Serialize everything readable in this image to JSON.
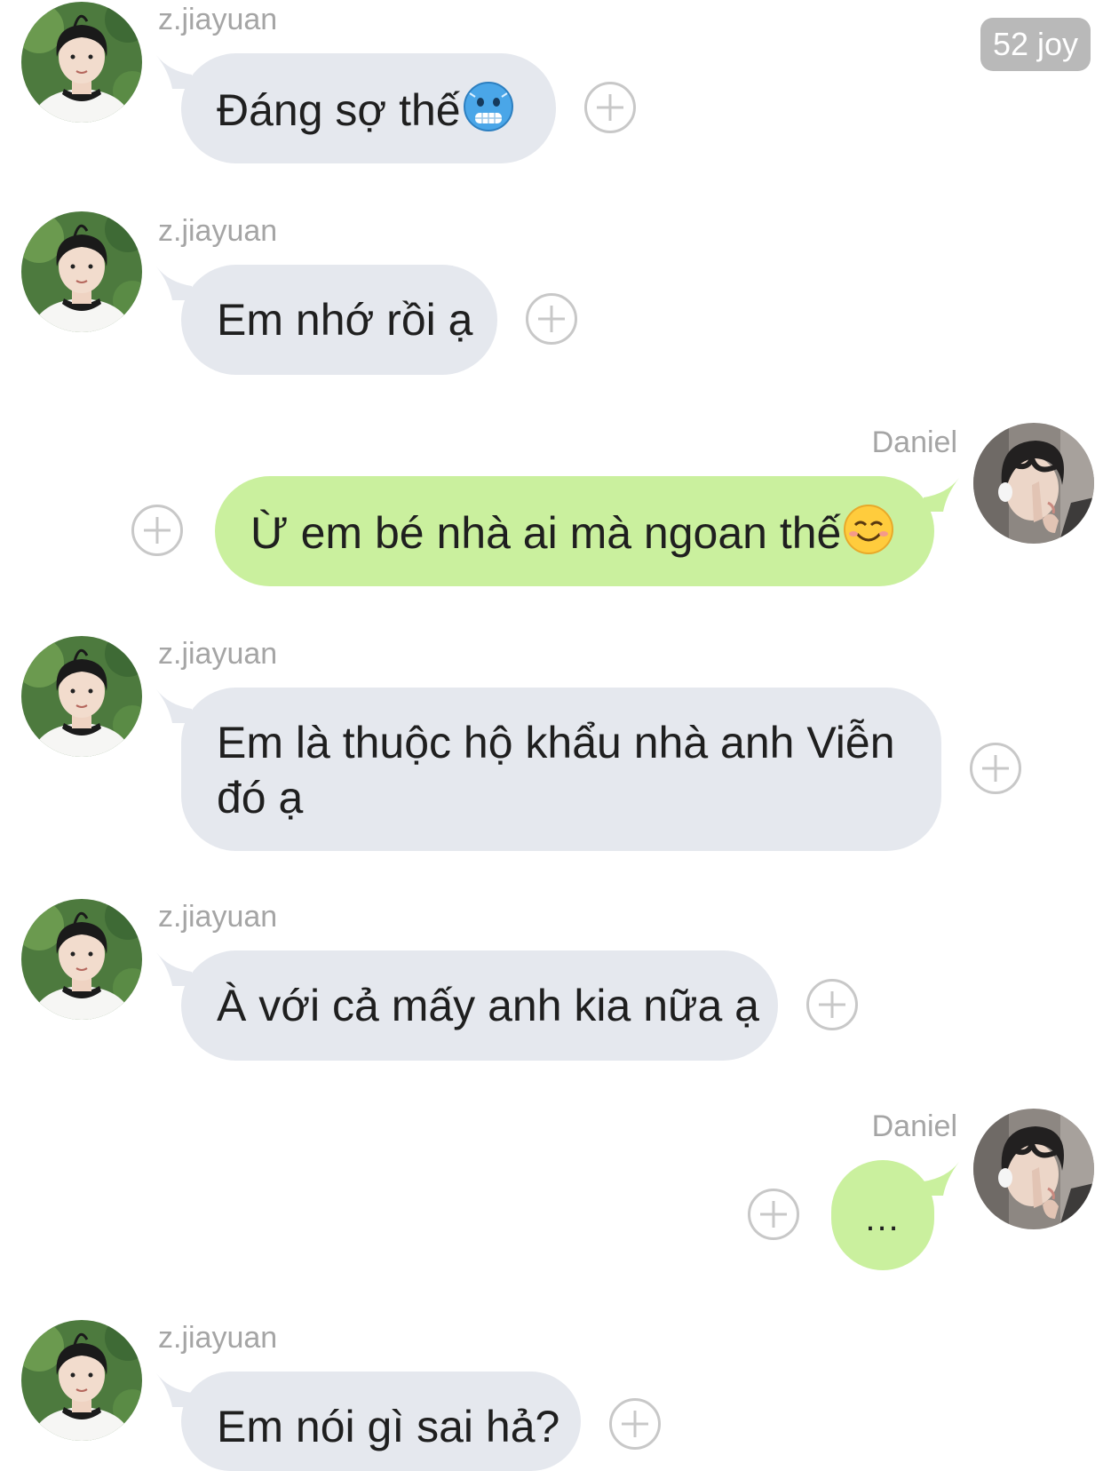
{
  "header": {
    "time_badge": "52 joy"
  },
  "messages": [
    {
      "sender": "z.jiayuan",
      "text": "Đáng sợ thế",
      "emoji": "cold-face-emoji"
    },
    {
      "sender": "z.jiayuan",
      "text": "Em nhớ rồi ạ"
    },
    {
      "sender": "Daniel",
      "text": "Ừ em bé nhà ai mà ngoan thế",
      "emoji": "smiling-face-emoji"
    },
    {
      "sender": "z.jiayuan",
      "text": "Em là thuộc hộ khẩu nhà anh Viễn đó ạ"
    },
    {
      "sender": "z.jiayuan",
      "text": "À với cả mấy anh kia nữa ạ"
    },
    {
      "sender": "Daniel",
      "text": "..."
    },
    {
      "sender": "z.jiayuan",
      "text": "Em nói gì sai hả?"
    }
  ],
  "colors": {
    "incoming_bubble": "#e5e8ee",
    "outgoing_bubble": "#caf09e",
    "sender_name": "#a5a5a5",
    "badge": "#b9b9b9"
  }
}
